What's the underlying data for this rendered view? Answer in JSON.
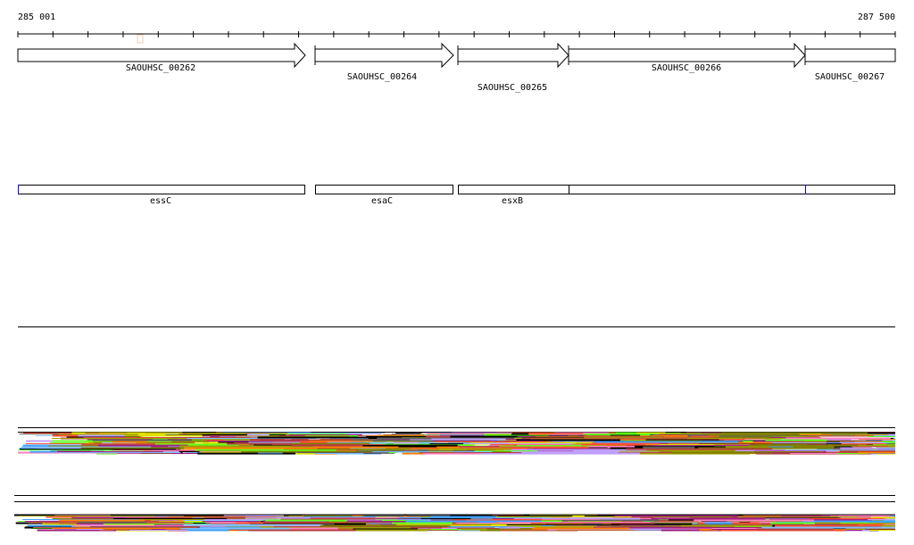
{
  "ruler": {
    "start_label": "285 001",
    "end_label": "287 500",
    "tick_count": 26
  },
  "genes": [
    {
      "id": "SAOUHSC_00262",
      "strand": "+"
    },
    {
      "id": "SAOUHSC_00264",
      "strand": "+"
    },
    {
      "id": "SAOUHSC_00265",
      "strand": "+"
    },
    {
      "id": "SAOUHSC_00266",
      "strand": "+"
    },
    {
      "id": "SAOUHSC_00267",
      "strand": "+"
    }
  ],
  "gene_names": [
    {
      "name": "essC"
    },
    {
      "name": "esaC"
    },
    {
      "name": "esxB"
    },
    {
      "name": ""
    },
    {
      "name": ""
    }
  ],
  "colors": {
    "outline": "#000000",
    "feature_edge": "#0000ff",
    "marker": "#f4c8b0",
    "read_palette": [
      "#000000",
      "#ff5030",
      "#a0a000",
      "#808000",
      "#c06030",
      "#a02080",
      "#60ff20",
      "#80c0ff",
      "#c0a0ff",
      "#e0e000",
      "#b04040",
      "#40a0ff",
      "#ff80c0",
      "#606060",
      "#ff8000"
    ]
  }
}
